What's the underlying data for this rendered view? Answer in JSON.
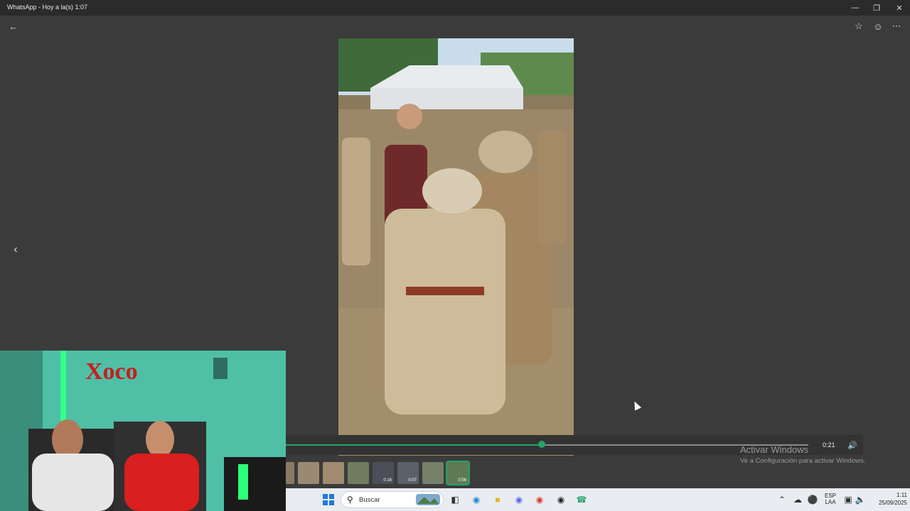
{
  "window": {
    "title": "WhatsApp - Hoy a la(s) 1:07",
    "controls": [
      "minimize-icon",
      "restore-icon",
      "close-icon"
    ]
  },
  "viewer": {
    "back_icon": "arrow-left-icon",
    "actions": [
      "star-icon",
      "emoji-icon",
      "more-icon"
    ],
    "prev_icon": "chevron-left-icon"
  },
  "player": {
    "time": "0:21",
    "progress": 0.49,
    "volume_icon": "speaker-icon",
    "accent": "#25a36a"
  },
  "thumbnails": [
    {
      "duration": ""
    },
    {
      "duration": ""
    },
    {
      "duration": ""
    },
    {
      "duration": ""
    },
    {
      "duration": "0:16"
    },
    {
      "duration": "0:07"
    },
    {
      "duration": ""
    },
    {
      "duration": "0:56",
      "selected": true
    }
  ],
  "watermark": {
    "line1": "Activar Windows",
    "line2": "Ve a Configuración para activar Windows."
  },
  "taskbar": {
    "search_placeholder": "Buscar",
    "lang_line1": "ESP",
    "lang_line2": "LAA",
    "time": "1:11",
    "date": "25/09/2025"
  }
}
